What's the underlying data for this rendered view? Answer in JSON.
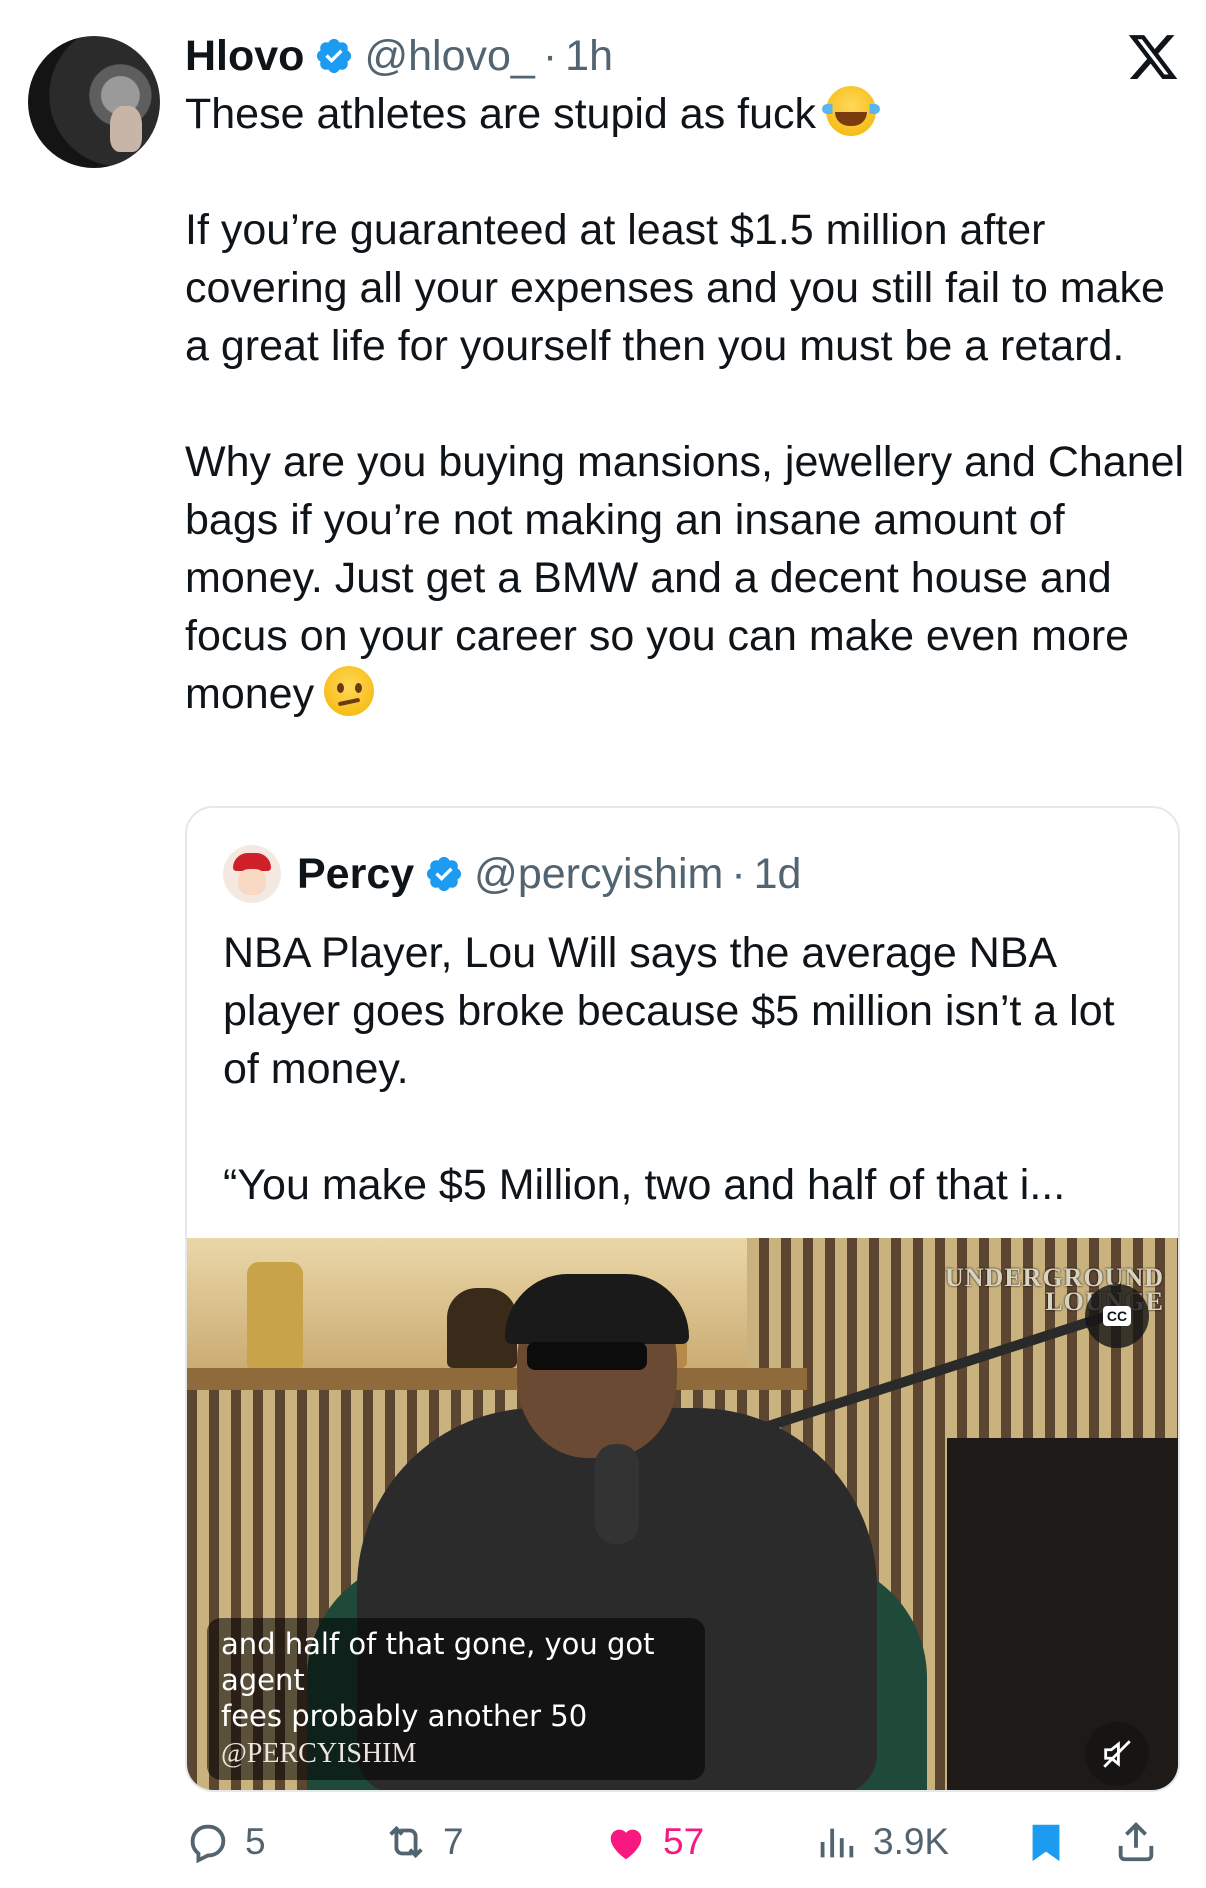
{
  "tweet": {
    "author_name": "Hlovo",
    "handle": "@hlovo_",
    "separator": "·",
    "time": "1h",
    "paragraphs": [
      "These athletes are stupid as fuck",
      "If you’re guaranteed at least $1.5 million after covering all your expenses and you still fail to make a great life for yourself then you must be a retard.",
      "Why are you buying mansions, jewellery and Chanel bags if you’re not making an insane amount of money. Just get a BMW and a decent house and focus on your career so you can make even more money"
    ],
    "emojis": [
      "face-with-tears-of-joy",
      "confused-face"
    ]
  },
  "quoted": {
    "author_name": "Percy",
    "handle": "@percyishim",
    "separator": "·",
    "time": "1d",
    "paragraphs": [
      "NBA Player, Lou Will says the average NBA player goes broke because $5 million isn’t a lot of money.",
      "“You make $5 Million, two and half of that i..."
    ],
    "video": {
      "watermark_line1": "UNDERGROUND",
      "watermark_line2": "LOUNGE",
      "cc_label": "CC",
      "caption_line1": "and half of that gone, you got agent",
      "caption_line2": "fees probably another 50",
      "caption_tag": "@PERCYISHIM"
    }
  },
  "actions": {
    "replies": "5",
    "reposts": "7",
    "likes": "57",
    "views": "3.9K"
  },
  "colors": {
    "verified": "#1d9bf0",
    "like": "#f91880",
    "bookmark": "#1d9bf0",
    "secondary_text": "#536471"
  }
}
